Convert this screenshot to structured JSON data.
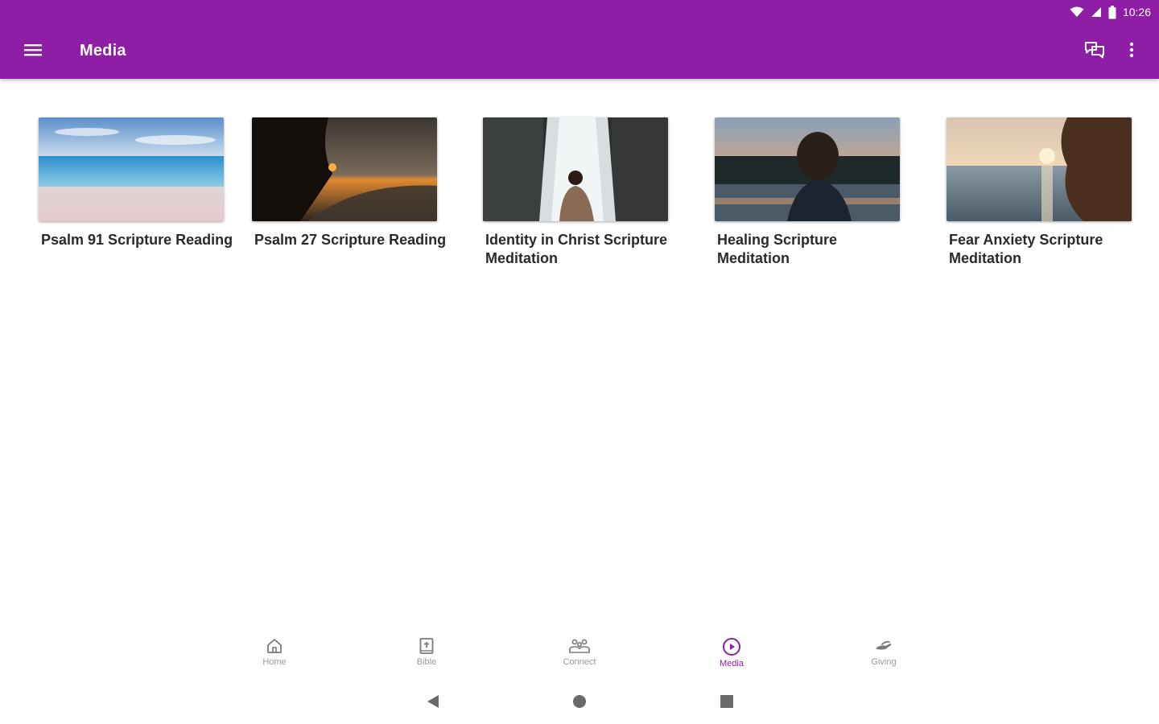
{
  "status_bar": {
    "time": "10:26",
    "wifi_icon": "wifi-icon",
    "signal_icon": "signal-icon",
    "battery_icon": "battery-icon"
  },
  "app_bar": {
    "title": "Media",
    "menu_icon": "hamburger-menu-icon",
    "actions": [
      {
        "icon": "chat-icon"
      },
      {
        "icon": "more-vert-icon"
      }
    ],
    "color": "#8e1ea6"
  },
  "media": {
    "items": [
      {
        "title": "Psalm 91 Scripture Reading",
        "thumbnail": "beach-sky-image"
      },
      {
        "title": "Psalm 27 Scripture Reading",
        "thumbnail": "sunset-coast-image"
      },
      {
        "title": "Identity in Christ Scripture Meditation",
        "thumbnail": "waterfall-person-image"
      },
      {
        "title": "Healing Scripture Meditation",
        "thumbnail": "woman-lake-image"
      },
      {
        "title": "Fear Anxiety Scripture Meditation",
        "thumbnail": "sea-sunset-hair-image"
      }
    ]
  },
  "bottom_nav": {
    "items": [
      {
        "label": "Home",
        "icon": "home-icon",
        "active": false
      },
      {
        "label": "Bible",
        "icon": "bible-icon",
        "active": false
      },
      {
        "label": "Connect",
        "icon": "connect-icon",
        "active": false
      },
      {
        "label": "Media",
        "icon": "play-circle-icon",
        "active": true
      },
      {
        "label": "Giving",
        "icon": "giving-hand-icon",
        "active": false
      }
    ],
    "active_color": "#8e1ea6",
    "inactive_color": "#9a9a9a"
  },
  "system_nav": {
    "back_icon": "back-triangle-icon",
    "home_icon": "home-circle-icon",
    "recents_icon": "recents-square-icon"
  }
}
